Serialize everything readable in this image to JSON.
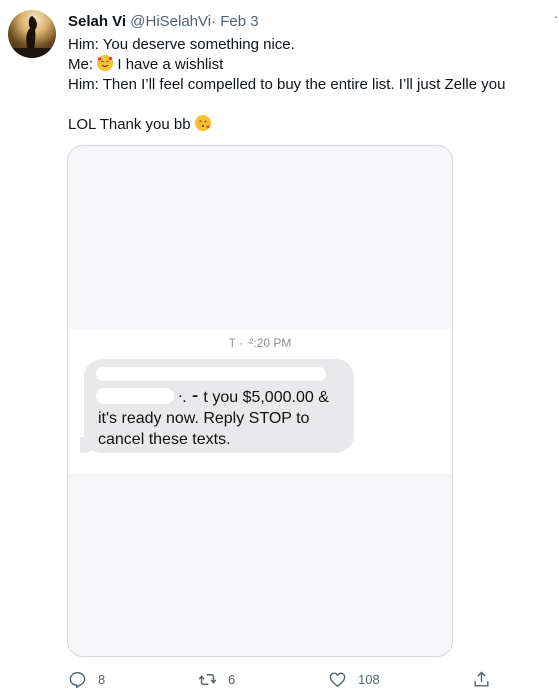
{
  "tweet": {
    "display_name": "Selah Vi",
    "handle": "@HiSelahVi",
    "separator": "·",
    "date": "Feb 3",
    "more_label": "·",
    "lines": [
      "Him: You deserve something nice.",
      "I have a wishlist",
      "Him: Then I’ll feel compelled to buy the entire list. I’ll just Zelle you",
      "LOL Thank you bb"
    ],
    "me_prefix": "Me:",
    "icons": {
      "avatar": "profile-photo",
      "me_emoji": "smiling-face-with-hearts-emoji",
      "lol_emoji": "face-blowing-kiss-emoji"
    }
  },
  "screenshot": {
    "time_label": "T  ·  ᐧ²:20 PM",
    "message_lines": [
      "ᐧ. ⁃ t you $5,000.00 &",
      "it's ready now. Reply STOP to",
      "cancel these texts."
    ]
  },
  "actions": {
    "reply_count": "8",
    "retweet_count": "6",
    "like_count": "108",
    "reply_icon": "reply-icon",
    "retweet_icon": "retweet-icon",
    "like_icon": "heart-icon",
    "share_icon": "share-icon"
  }
}
